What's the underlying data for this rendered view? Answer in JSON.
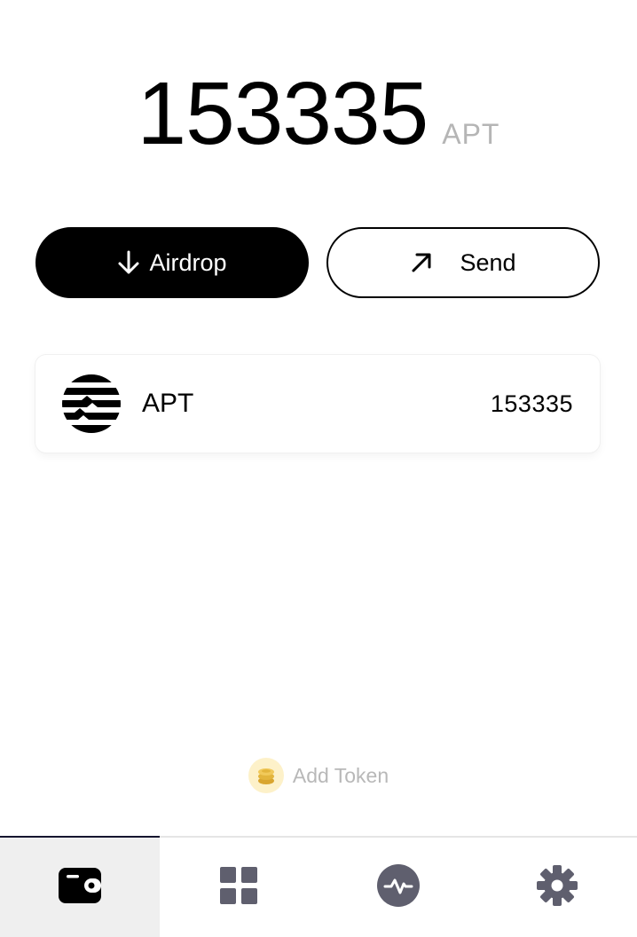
{
  "balance": {
    "amount": "153335",
    "unit": "APT"
  },
  "actions": {
    "airdrop_label": "Airdrop",
    "send_label": "Send"
  },
  "tokens": [
    {
      "symbol": "APT",
      "balance": "153335",
      "icon": "aptos-logo-icon"
    }
  ],
  "add_token": {
    "label": "Add Token",
    "icon": "coins-icon"
  },
  "nav": {
    "items": [
      {
        "icon": "wallet-icon",
        "active": true
      },
      {
        "icon": "grid-icon",
        "active": false
      },
      {
        "icon": "activity-icon",
        "active": false
      },
      {
        "icon": "gear-icon",
        "active": false
      }
    ]
  },
  "colors": {
    "primary": "#000000",
    "muted": "#b5b5b5",
    "nav_icon": "#5f5f6e",
    "coin_bg": "#fdf1c9",
    "coin": "#e3b53c"
  }
}
